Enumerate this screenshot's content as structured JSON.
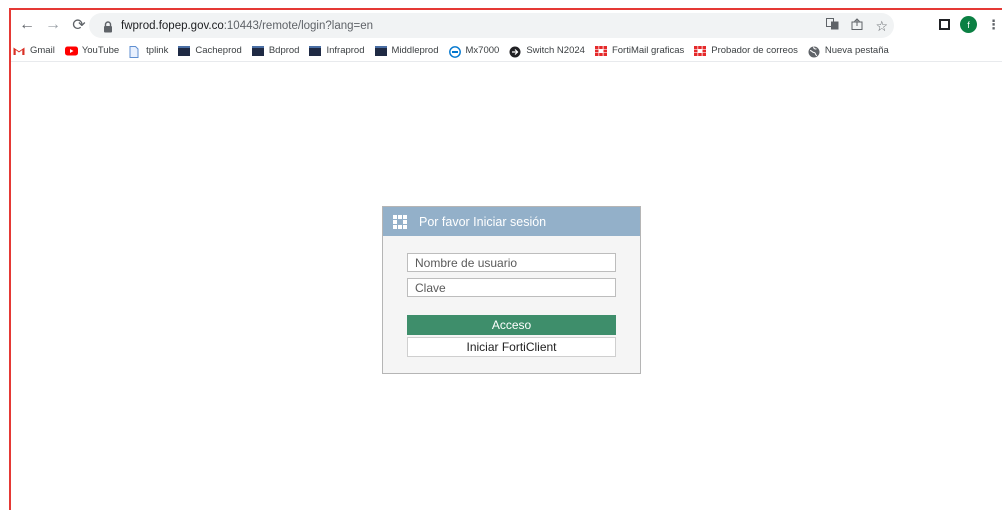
{
  "browser": {
    "url_host": "fwprod.fopep.gov.co",
    "url_rest": ":10443/remote/login?lang=en",
    "avatar_letter": "f",
    "icons": [
      "back-icon",
      "forward-icon",
      "reload-icon",
      "lock-icon",
      "translate-icon",
      "share-icon",
      "star-icon",
      "sidepanel-icon",
      "kebab-icon"
    ]
  },
  "bookmarks": [
    {
      "label": "Gmail",
      "icon": "gmail-icon"
    },
    {
      "label": "YouTube",
      "icon": "youtube-icon"
    },
    {
      "label": "tplink",
      "icon": "page-icon"
    },
    {
      "label": "Cacheprod",
      "icon": "terminal-icon"
    },
    {
      "label": "Bdprod",
      "icon": "terminal-icon"
    },
    {
      "label": "Infraprod",
      "icon": "terminal-icon"
    },
    {
      "label": "Middleprod",
      "icon": "terminal-icon"
    },
    {
      "label": "Mx7000",
      "icon": "dell-icon"
    },
    {
      "label": "Switch N2024",
      "icon": "switch-icon"
    },
    {
      "label": "FortiMail graficas",
      "icon": "fortinet-icon"
    },
    {
      "label": "Probador de correos",
      "icon": "fortinet-icon"
    },
    {
      "label": "Nueva pestaña",
      "icon": "globe-icon"
    }
  ],
  "login": {
    "title": "Por favor Iniciar sesión",
    "username_placeholder": "Nombre de usuario",
    "password_placeholder": "Clave",
    "login_button": "Acceso",
    "forticlient_button": "Iniciar FortiClient"
  },
  "colors": {
    "header": "#93b0c9",
    "login_button": "#3e8e6b",
    "frame": "#e53935"
  }
}
